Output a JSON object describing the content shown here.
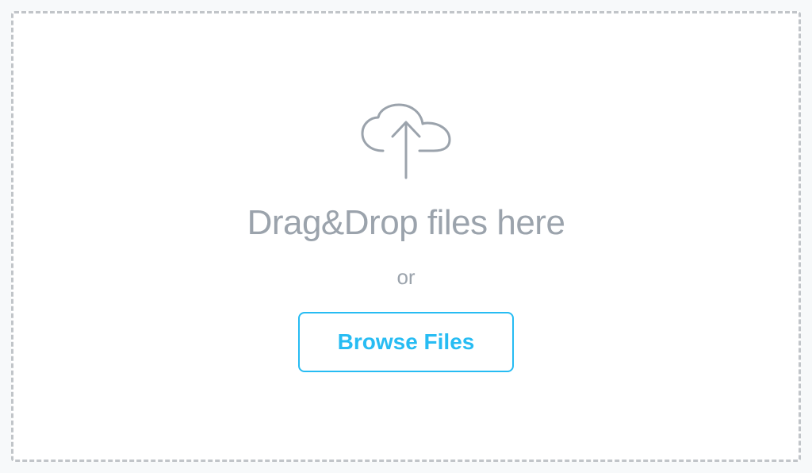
{
  "uploader": {
    "drag_drop_label": "Drag&Drop files here",
    "separator_label": "or",
    "browse_button_label": "Browse Files"
  }
}
